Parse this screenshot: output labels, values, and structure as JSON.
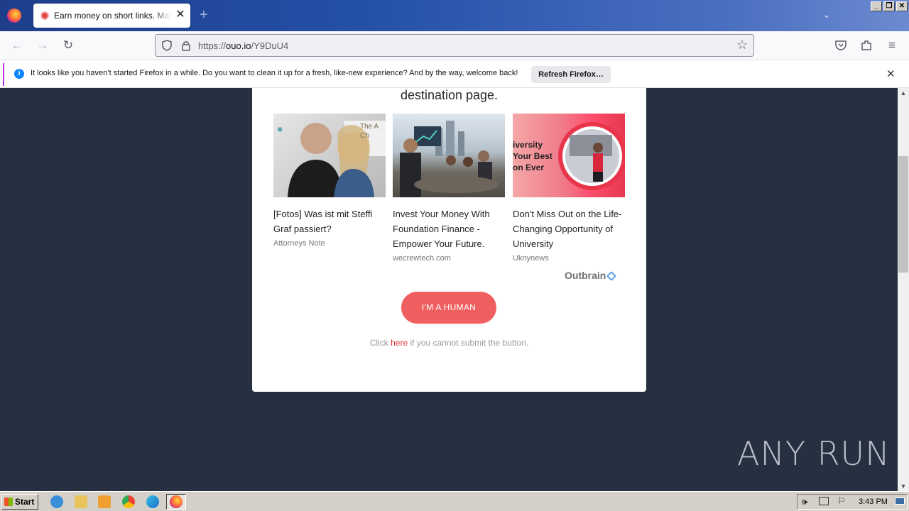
{
  "browser": {
    "tab_title": "Earn money on short links. Make sh",
    "url_prefix": "https://",
    "url_host": "ouo.io",
    "url_path": "/Y9DuU4",
    "new_tab": "+",
    "tab_close": "✕"
  },
  "notification": {
    "message": "It looks like you haven’t started Firefox in a while. Do you want to clean it up for a fresh, like-new experience? And by the way, welcome back!",
    "button": "Refresh Firefox…",
    "close": "✕"
  },
  "page": {
    "heading": "destination page.",
    "ads": [
      {
        "title": "[Fotos] Was ist mit Steffi Graf passiert?",
        "source": "Attorneys Note"
      },
      {
        "title": "Invest Your Money With Foundation Finance - Empower Your Future.",
        "source": "wecrewtech.com"
      },
      {
        "title": "Don't Miss Out on the Life-Changing Opportunity of University",
        "source": "Uknynews"
      }
    ],
    "ad3_image_text": "iversity\nYour Best\non Ever",
    "ad1_image_text": "The A\nCh",
    "outbrain": "Outbrain",
    "human_button": "I'M A HUMAN",
    "click_prefix": "Click ",
    "click_link": "here",
    "click_suffix": " if you cannot submit the button."
  },
  "watermark": "ANY RUN",
  "taskbar": {
    "start": "Start",
    "clock": "3:43 PM"
  }
}
